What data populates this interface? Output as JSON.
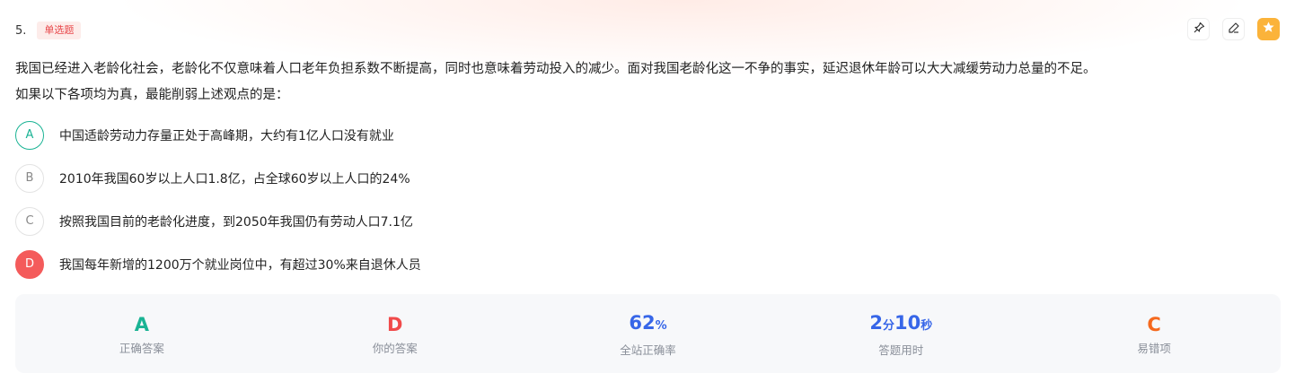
{
  "question": {
    "number": "5.",
    "type_badge": "单选题",
    "stem_line1": "我国已经进入老龄化社会，老龄化不仅意味着人口老年负担系数不断提高，同时也意味着劳动投入的减少。面对我国老龄化这一不争的事实，延迟退休年龄可以大大减缓劳动力总量的不足。",
    "stem_line2": "如果以下各项均为真，最能削弱上述观点的是："
  },
  "toolbar": {
    "icons": [
      "pin-icon",
      "edit-icon",
      "star-icon"
    ],
    "colors": {
      "star_bg": "#fbb33a"
    }
  },
  "options": [
    {
      "letter": "A",
      "text": "中国适龄劳动力存量正处于高峰期，大约有1亿人口没有就业",
      "state": "correct"
    },
    {
      "letter": "B",
      "text": "2010年我国60岁以上人口1.8亿，占全球60岁以上人口的24%",
      "state": "normal"
    },
    {
      "letter": "C",
      "text": "按照我国目前的老龄化进度，到2050年我国仍有劳动人口7.1亿",
      "state": "normal"
    },
    {
      "letter": "D",
      "text": "我国每年新增的1200万个就业岗位中，有超过30%来自退休人员",
      "state": "wrong"
    }
  ],
  "stats": {
    "correct_answer": {
      "value": "A",
      "label": "正确答案"
    },
    "your_answer": {
      "value": "D",
      "label": "你的答案"
    },
    "accuracy": {
      "value": "62",
      "unit": "%",
      "label": "全站正确率"
    },
    "time": {
      "min": "2",
      "min_unit": "分",
      "sec": "10",
      "sec_unit": "秒",
      "label": "答题用时"
    },
    "common_wrong": {
      "value": "C",
      "label": "易错项"
    }
  },
  "colors": {
    "correct": "#1ab394",
    "wrong": "#f45b5b",
    "blue": "#3766e8",
    "orange": "#f5691e"
  }
}
